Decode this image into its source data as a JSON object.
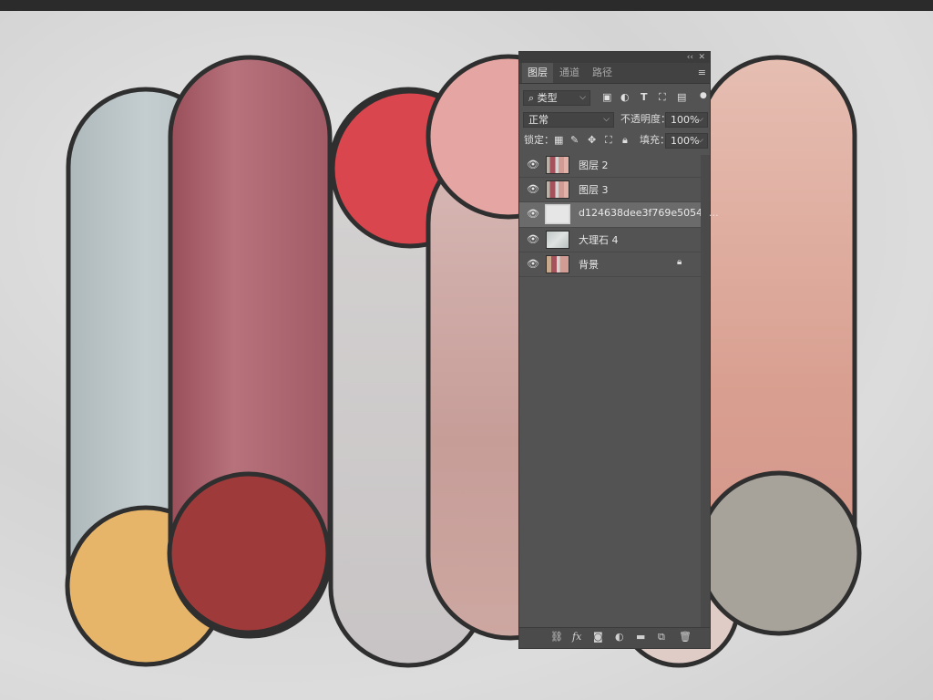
{
  "panel": {
    "collapse_glyph": "‹‹",
    "close_glyph": "✕",
    "tabs": [
      {
        "label": "图层",
        "active": true
      },
      {
        "label": "通道",
        "active": false
      },
      {
        "label": "路径",
        "active": false
      }
    ],
    "menu_icon": "hamburger-icon",
    "filter": {
      "label": "类型",
      "icons": [
        "image-filter-icon",
        "adjustment-filter-icon",
        "type-filter-icon",
        "shape-filter-icon",
        "smart-object-filter-icon"
      ]
    },
    "blend_mode": "正常",
    "opacity_label": "不透明度：",
    "opacity_value": "100%",
    "lock_label": "锁定：",
    "fill_label": "填充：",
    "fill_value": "100%",
    "layers": [
      {
        "name": "图层 2",
        "visible": true,
        "selected": false,
        "locked": false
      },
      {
        "name": "图层 3",
        "visible": true,
        "selected": false,
        "locked": false
      },
      {
        "name": "d124638dee3f769e5054b...",
        "visible": true,
        "selected": true,
        "locked": false
      },
      {
        "name": "大理石 4",
        "visible": true,
        "selected": false,
        "locked": false
      },
      {
        "name": "背景",
        "visible": true,
        "selected": false,
        "locked": true
      }
    ],
    "bottom_icons": [
      "link-layers-icon",
      "fx-icon",
      "mask-icon",
      "adjustment-layer-icon",
      "new-group-icon",
      "new-layer-icon",
      "trash-icon"
    ]
  },
  "colors": {
    "panel_bg": "#535353",
    "selected_layer": "#6b6b6b",
    "outline": "#2f2f2f"
  }
}
